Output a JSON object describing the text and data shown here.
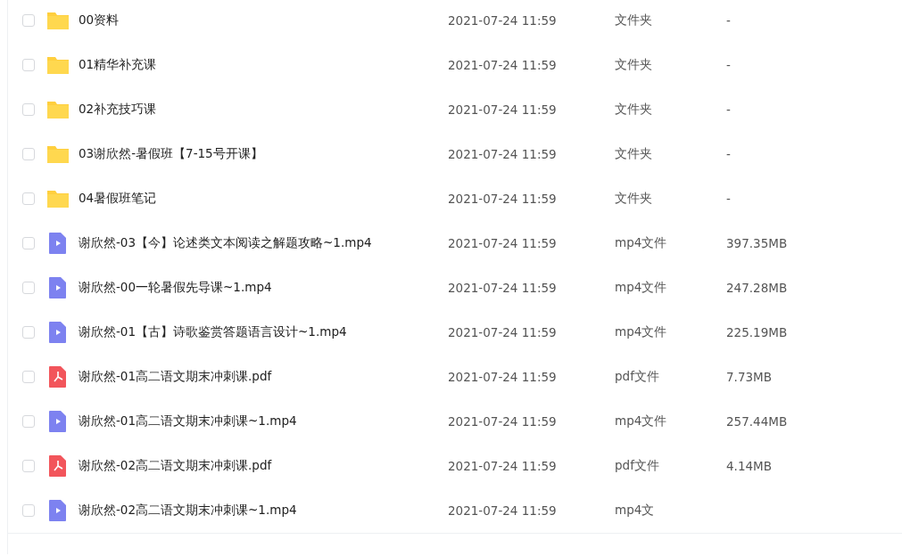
{
  "files": [
    {
      "kind": "folder",
      "name": "00资料",
      "checked": false,
      "modified": "2021-07-24 11:59",
      "type": "文件夹",
      "size": "-"
    },
    {
      "kind": "folder",
      "name": "01精华补充课",
      "checked": false,
      "modified": "2021-07-24 11:59",
      "type": "文件夹",
      "size": "-"
    },
    {
      "kind": "folder",
      "name": "02补充技巧课",
      "checked": false,
      "modified": "2021-07-24 11:59",
      "type": "文件夹",
      "size": "-"
    },
    {
      "kind": "folder",
      "name": "03谢欣然-暑假班【7-15号开课】",
      "checked": false,
      "modified": "2021-07-24 11:59",
      "type": "文件夹",
      "size": "-"
    },
    {
      "kind": "folder",
      "name": "04暑假班笔记",
      "checked": false,
      "modified": "2021-07-24 11:59",
      "type": "文件夹",
      "size": "-"
    },
    {
      "kind": "video",
      "name": "谢欣然-03【今】论述类文本阅读之解题攻略~1.mp4",
      "checked": false,
      "modified": "2021-07-24 11:59",
      "type": "mp4文件",
      "size": "397.35MB"
    },
    {
      "kind": "video",
      "name": "谢欣然-00一轮暑假先导课~1.mp4",
      "checked": false,
      "modified": "2021-07-24 11:59",
      "type": "mp4文件",
      "size": "247.28MB"
    },
    {
      "kind": "video",
      "name": "谢欣然-01【古】诗歌鉴赏答题语言设计~1.mp4",
      "checked": false,
      "modified": "2021-07-24 11:59",
      "type": "mp4文件",
      "size": "225.19MB"
    },
    {
      "kind": "pdf",
      "name": "谢欣然-01高二语文期末冲刺课.pdf",
      "checked": false,
      "modified": "2021-07-24 11:59",
      "type": "pdf文件",
      "size": "7.73MB"
    },
    {
      "kind": "video",
      "name": "谢欣然-01高二语文期末冲刺课~1.mp4",
      "checked": false,
      "modified": "2021-07-24 11:59",
      "type": "mp4文件",
      "size": "257.44MB"
    },
    {
      "kind": "pdf",
      "name": "谢欣然-02高二语文期末冲刺课.pdf",
      "checked": false,
      "modified": "2021-07-24 11:59",
      "type": "pdf文件",
      "size": "4.14MB"
    },
    {
      "kind": "video",
      "name": "谢欣然-02高二语文期末冲刺课~1.mp4",
      "checked": false,
      "modified": "2021-07-24 11:59",
      "type": "mp4文"
    }
  ]
}
